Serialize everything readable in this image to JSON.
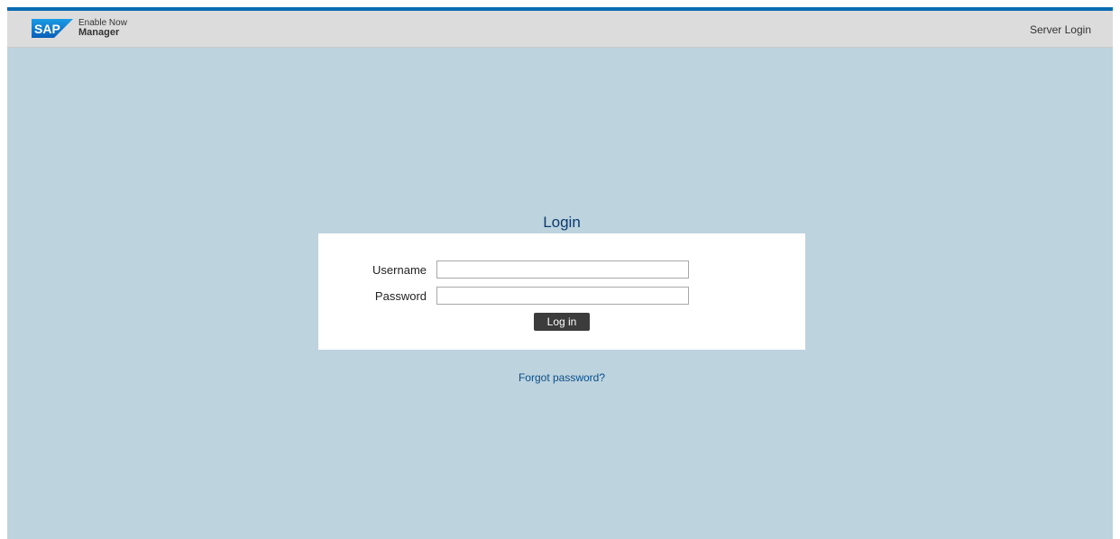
{
  "header": {
    "logo_text": "SAP",
    "product_line1": "Enable Now",
    "product_line2": "Manager",
    "server_login_label": "Server Login"
  },
  "login": {
    "title": "Login",
    "username_label": "Username",
    "username_value": "",
    "password_label": "Password",
    "password_value": "",
    "submit_label": "Log in",
    "forgot_password_label": "Forgot password?"
  },
  "colors": {
    "background": "#bdd3de",
    "header": "#dcdcdc",
    "accent_line": "#0a6cb3",
    "title": "#0d3b6e",
    "button": "#3c3c3c",
    "link": "#0b4f8a"
  }
}
